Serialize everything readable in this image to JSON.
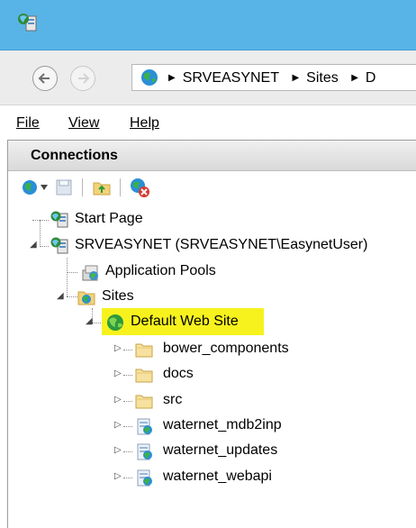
{
  "address_bar": {
    "crumbs": [
      "SRVEASYNET",
      "Sites",
      "D"
    ]
  },
  "menu": {
    "items": [
      "File",
      "View",
      "Help"
    ]
  },
  "connections": {
    "title": "Connections"
  },
  "tree": {
    "start_page": "Start Page",
    "server": "SRVEASYNET (SRVEASYNET\\EasynetUser)",
    "app_pools": "Application Pools",
    "sites": "Sites",
    "default_site": "Default Web Site",
    "children": [
      {
        "label": "bower_components",
        "type": "folder-icon"
      },
      {
        "label": "docs",
        "type": "folder-icon"
      },
      {
        "label": "src",
        "type": "folder-icon"
      },
      {
        "label": "waternet_mdb2inp",
        "type": "web-application-icon"
      },
      {
        "label": "waternet_updates",
        "type": "web-application-icon"
      },
      {
        "label": "waternet_webapi",
        "type": "web-application-icon"
      }
    ]
  },
  "colors": {
    "titlebar": "#58b4e7",
    "highlight": "#f7f21e"
  }
}
